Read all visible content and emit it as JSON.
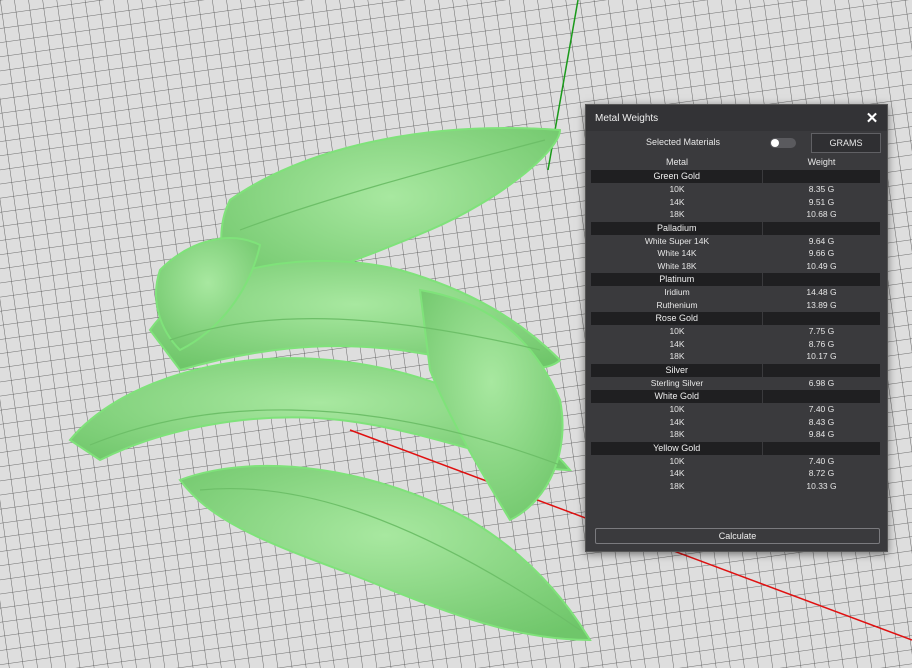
{
  "panel": {
    "title": "Metal Weights",
    "selected_materials_label": "Selected Materials",
    "units_button": "GRAMS",
    "col_metal": "Metal",
    "col_weight": "Weight",
    "calculate_label": "Calculate"
  },
  "groups": [
    {
      "name": "Green Gold",
      "items": [
        {
          "metal": "10K",
          "weight": "8.35 G"
        },
        {
          "metal": "14K",
          "weight": "9.51 G"
        },
        {
          "metal": "18K",
          "weight": "10.68 G"
        }
      ]
    },
    {
      "name": "Palladium",
      "items": [
        {
          "metal": "White Super 14K",
          "weight": "9.64 G"
        },
        {
          "metal": "White 14K",
          "weight": "9.66 G"
        },
        {
          "metal": "White 18K",
          "weight": "10.49 G"
        }
      ]
    },
    {
      "name": "Platinum",
      "items": [
        {
          "metal": "Iridium",
          "weight": "14.48 G"
        },
        {
          "metal": "Ruthenium",
          "weight": "13.89 G"
        }
      ]
    },
    {
      "name": "Rose Gold",
      "items": [
        {
          "metal": "10K",
          "weight": "7.75 G"
        },
        {
          "metal": "14K",
          "weight": "8.76 G"
        },
        {
          "metal": "18K",
          "weight": "10.17 G"
        }
      ]
    },
    {
      "name": "Silver",
      "items": [
        {
          "metal": "Sterling Silver",
          "weight": "6.98 G"
        }
      ]
    },
    {
      "name": "White Gold",
      "items": [
        {
          "metal": "10K",
          "weight": "7.40 G"
        },
        {
          "metal": "14K",
          "weight": "8.43 G"
        },
        {
          "metal": "18K",
          "weight": "9.84 G"
        }
      ]
    },
    {
      "name": "Yellow Gold",
      "items": [
        {
          "metal": "10K",
          "weight": "7.40 G"
        },
        {
          "metal": "14K",
          "weight": "8.72 G"
        },
        {
          "metal": "18K",
          "weight": "10.33 G"
        }
      ]
    }
  ],
  "colors": {
    "model_green": "#8fdc8a",
    "axis_green": "#1a9a1a",
    "axis_red": "#e01010",
    "grid_background": "#d9d9d9",
    "panel_background": "#3a3a3d"
  },
  "selected_materials_toggle": false
}
